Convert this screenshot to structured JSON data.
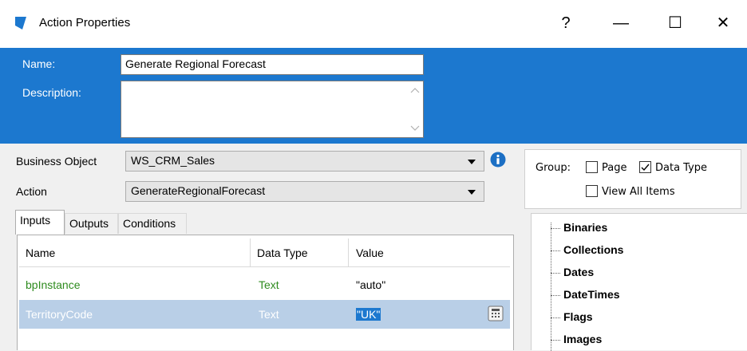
{
  "window": {
    "title": "Action Properties",
    "help_label": "?",
    "minimize_label": "—",
    "maximize_label": "☐",
    "close_label": "✕"
  },
  "header": {
    "name_label": "Name:",
    "name_value": "Generate Regional Forecast",
    "description_label": "Description:",
    "description_value": ""
  },
  "fields": {
    "business_object_label": "Business Object",
    "business_object_value": "WS_CRM_Sales",
    "action_label": "Action",
    "action_value": "GenerateRegionalForecast"
  },
  "tabs": [
    {
      "label": "Inputs",
      "active": true
    },
    {
      "label": "Outputs",
      "active": false
    },
    {
      "label": "Conditions",
      "active": false
    }
  ],
  "grid": {
    "columns": [
      "Name",
      "Data Type",
      "Value"
    ],
    "rows": [
      {
        "name": "bpInstance",
        "type": "Text",
        "value": "\"auto\""
      },
      {
        "name": "TerritoryCode",
        "type": "Text",
        "value": "\"UK\"",
        "selected": true
      }
    ]
  },
  "group": {
    "label": "Group:",
    "page_label": "Page",
    "page_checked": false,
    "datatype_label": "Data Type",
    "datatype_checked": true,
    "viewall_label": "View All Items",
    "viewall_checked": false
  },
  "tree": {
    "items": [
      "Binaries",
      "Collections",
      "Dates",
      "DateTimes",
      "Flags",
      "Images"
    ]
  },
  "colors": {
    "header_blue": "#1c78cf",
    "selected_row": "#b9cfe7",
    "green_text": "#2e8b1e",
    "info_blue": "#1c6fc4"
  }
}
